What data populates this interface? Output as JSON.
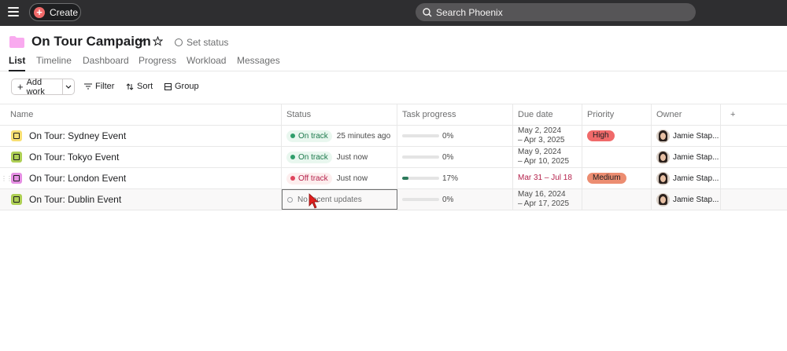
{
  "topbar": {
    "create_label": "Create",
    "search_placeholder": "Search Phoenix"
  },
  "project": {
    "title": "On Tour Campaign",
    "set_status_label": "Set status",
    "folder_color": "#f9aaef"
  },
  "tabs": [
    {
      "label": "List",
      "active": true
    },
    {
      "label": "Timeline"
    },
    {
      "label": "Dashboard"
    },
    {
      "label": "Progress"
    },
    {
      "label": "Workload"
    },
    {
      "label": "Messages"
    }
  ],
  "toolbar": {
    "add_work_label": "Add work",
    "filter_label": "Filter",
    "sort_label": "Sort",
    "group_label": "Group"
  },
  "table": {
    "columns": [
      "Name",
      "Status",
      "Task progress",
      "Due date",
      "Priority",
      "Owner",
      "+"
    ],
    "rows": [
      {
        "name": "On Tour: Sydney Event",
        "icon_color": "#f8df72",
        "status": "On track",
        "status_type": "on",
        "status_time": "25 minutes ago",
        "progress": "0%",
        "progress_value": 0,
        "due_line1": "May 2, 2024",
        "due_line2": "– Apr 3, 2025",
        "priority": "High",
        "priority_color": "#f06a6a",
        "owner": "Jamie Stap..."
      },
      {
        "name": "On Tour: Tokyo Event",
        "icon_color": "#aecf55",
        "status": "On track",
        "status_type": "on",
        "status_time": "Just now",
        "progress": "0%",
        "progress_value": 0,
        "due_line1": "May 9, 2024",
        "due_line2": "– Apr 10, 2025",
        "priority": "",
        "priority_color": "",
        "owner": "Jamie Stap..."
      },
      {
        "name": "On Tour: London Event",
        "icon_color": "#e58fe3",
        "status": "Off track",
        "status_type": "off",
        "status_time": "Just now",
        "progress": "17%",
        "progress_value": 0.17,
        "due_line1": "Mar 31 – Jul 18",
        "due_line2": "",
        "due_overdue": true,
        "priority": "Medium",
        "priority_color": "#ec8d71",
        "owner": "Jamie Stap..."
      },
      {
        "name": "On Tour: Dublin Event",
        "icon_color": "#aecf55",
        "status": "No recent updates",
        "status_type": "none",
        "status_time": "",
        "progress": "0%",
        "progress_value": 0,
        "due_line1": "May 16, 2024",
        "due_line2": "– Apr 17, 2025",
        "priority": "",
        "priority_color": "",
        "owner": "Jamie Stap..."
      }
    ]
  }
}
